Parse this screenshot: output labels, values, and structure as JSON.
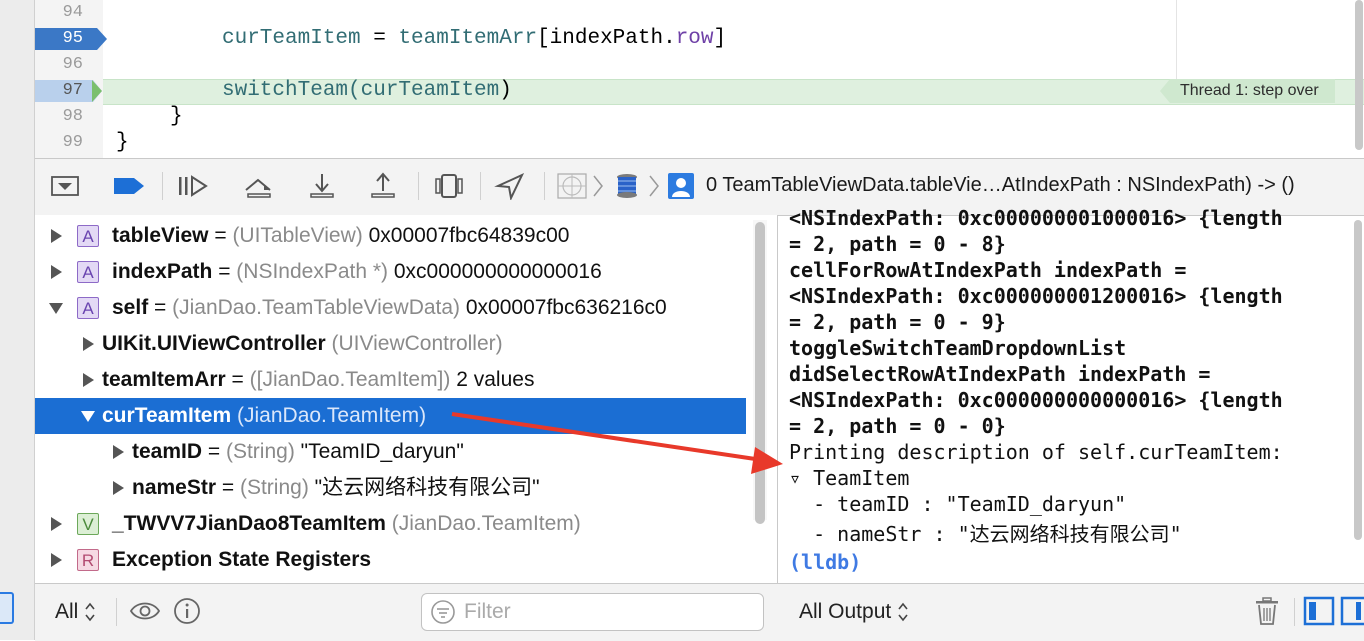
{
  "editor": {
    "lines": [
      {
        "num": "94",
        "code": ""
      },
      {
        "num": "95",
        "code_parts": [
          "curTeamItem",
          " = ",
          "teamItemArr",
          "[indexPath.",
          "row",
          "]"
        ]
      },
      {
        "num": "96",
        "code": ""
      },
      {
        "num": "97",
        "code_parts": [
          "switchTeam(",
          "curTeamItem",
          ")"
        ]
      },
      {
        "num": "98",
        "code": "}"
      },
      {
        "num": "99",
        "code": "}"
      }
    ],
    "thread_label": "Thread 1: step over"
  },
  "toolbar": {
    "icons": [
      "hide-debug-area-icon",
      "breakpoints-toggle-icon",
      "continue-icon",
      "step-over-icon",
      "step-into-icon",
      "step-out-icon",
      "view-hierarchy-icon",
      "simulate-location-icon",
      "memory-graph-icon",
      "thread-icon",
      "frame-icon"
    ],
    "frame_label": "0 TeamTableViewData.tableVie…AtIndexPath : NSIndexPath) -> ()"
  },
  "variables": [
    {
      "badge": "A",
      "name": "tableView",
      "eq": " = ",
      "type": "(UITableView)",
      "value": " 0x00007fbc64839c00",
      "expanded": false
    },
    {
      "badge": "A",
      "name": "indexPath",
      "eq": " = ",
      "type": "(NSIndexPath *)",
      "value": " 0xc000000000000016",
      "expanded": false
    },
    {
      "badge": "A",
      "name": "self",
      "eq": " = ",
      "type": "(JianDao.TeamTableViewData)",
      "value": " 0x00007fbc636216c0",
      "expanded": true
    },
    {
      "name": "UIKit.UIViewController",
      "eq": " ",
      "type": "(UIViewController)",
      "value": "",
      "expanded": false
    },
    {
      "name": "teamItemArr",
      "eq": " = ",
      "type": "([JianDao.TeamItem])",
      "value": " 2 values",
      "expanded": false
    },
    {
      "name": "curTeamItem",
      "eq": " ",
      "type": "(JianDao.TeamItem)",
      "value": "",
      "expanded": true,
      "selected": true
    },
    {
      "name": "teamID",
      "eq": " = ",
      "type": "(String)",
      "value": " \"TeamID_daryun\"",
      "expanded": false
    },
    {
      "name": "nameStr",
      "eq": " = ",
      "type": "(String)",
      "value": " \"达云网络科技有限公司\"",
      "expanded": false
    },
    {
      "badge": "V",
      "name": "_TWVV7JianDao8TeamItem",
      "eq": " ",
      "type": "(JianDao.TeamItem)",
      "value": "",
      "expanded": false
    },
    {
      "badge": "R",
      "name": "Exception State Registers",
      "eq": "",
      "type": "",
      "value": "",
      "expanded": false
    }
  ],
  "console": {
    "lines": [
      "<NSIndexPath: 0xc000000001000016> {length",
      "= 2, path = 0 - 8}",
      "cellForRowAtIndexPath indexPath =",
      "<NSIndexPath: 0xc000000001200016> {length",
      "= 2, path = 0 - 9}",
      "toggleSwitchTeamDropdownList",
      "didSelectRowAtIndexPath indexPath =",
      "<NSIndexPath: 0xc000000000000016> {length",
      "= 2, path = 0 - 0}",
      "Printing description of self.curTeamItem:",
      "▿ TeamItem",
      "  - teamID : \"TeamID_daryun\"",
      "  - nameStr : \"达云网络科技有限公司\"",
      "(lldb)"
    ]
  },
  "bottom": {
    "scope_label": "All",
    "filter_placeholder": "Filter",
    "output_label": "All Output"
  },
  "colors": {
    "selection": "#1b6ed3",
    "breakpoint": "#3b78c6",
    "current_line": "#dff0df",
    "annotation_arrow": "#e8392a",
    "lldb_prompt": "#3f7ae3"
  }
}
